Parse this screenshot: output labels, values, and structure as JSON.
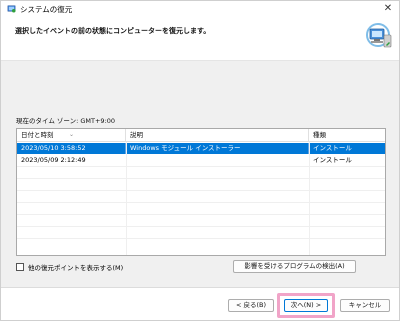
{
  "window": {
    "title": "システムの復元",
    "close_glyph": "✕"
  },
  "header": {
    "instruction": "選択したイベントの前の状態にコンピューターを復元します。"
  },
  "timezone_label": "現在のタイム ゾーン: GMT+9:00",
  "table": {
    "columns": [
      "日付と時刻",
      "説明",
      "種類"
    ],
    "sort_glyph": "⌄",
    "rows": [
      {
        "date": "2023/05/10 3:58:52",
        "description": "Windows モジュール インストーラー",
        "type": "インストール",
        "selected": true
      },
      {
        "date": "2023/05/09 2:12:49",
        "description": "",
        "type": "インストール",
        "selected": false
      }
    ]
  },
  "show_more_checkbox": {
    "label": "他の復元ポイントを表示する(M)",
    "checked": false
  },
  "buttons": {
    "detect": "影響を受けるプログラムの検出(A)",
    "back": "< 戻る(B)",
    "next": "次へ(N) >",
    "cancel": "キャンセル"
  },
  "colors": {
    "selection": "#0078d7",
    "highlight": "#f1a4c8",
    "panel": "#f0f0f0"
  },
  "icons": {
    "title_icon": "system-restore-icon",
    "header_icon": "computer-restore-icon"
  }
}
